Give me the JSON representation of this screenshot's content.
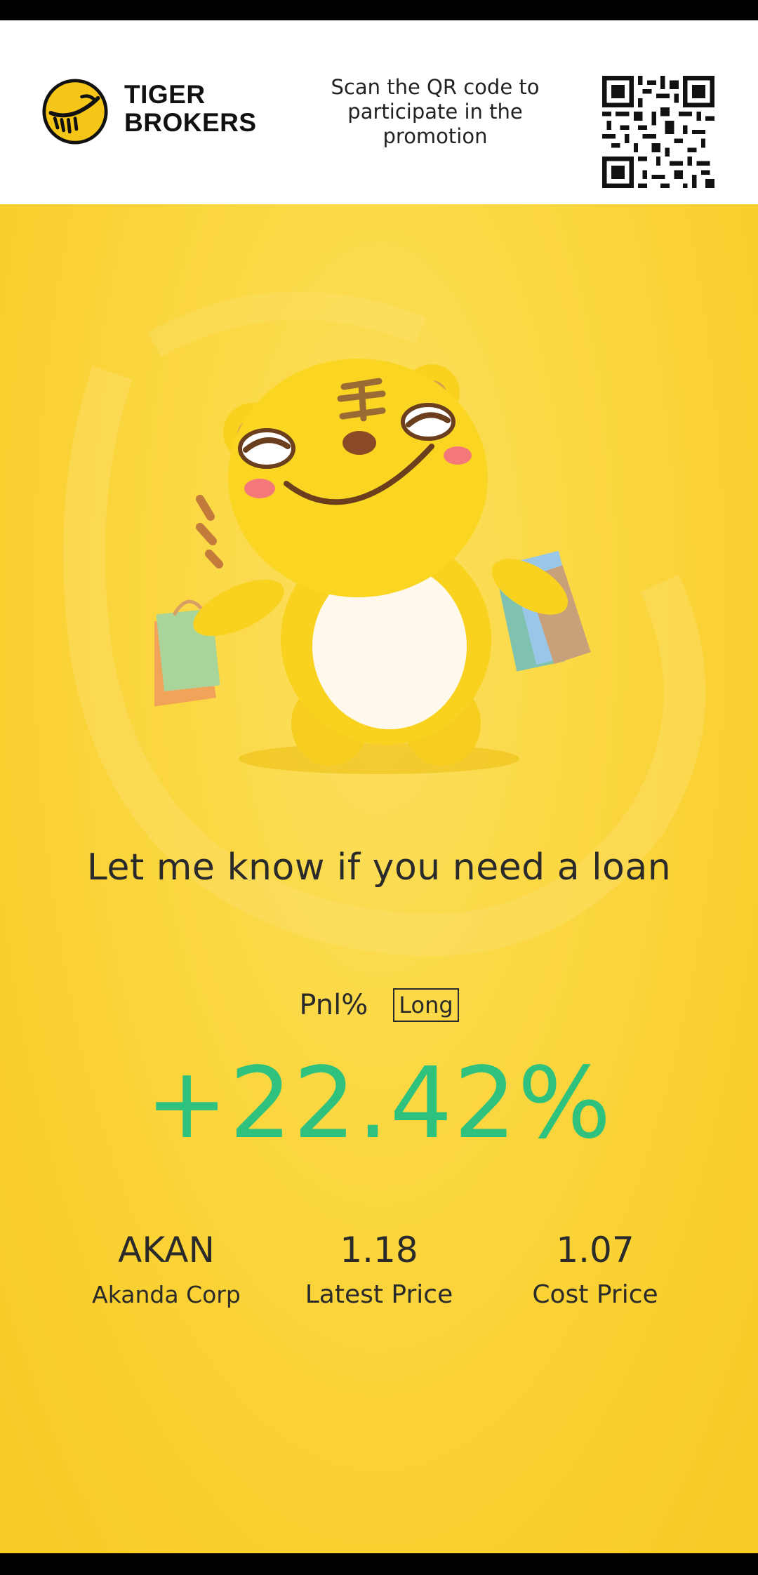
{
  "header": {
    "brand_line1": "TIGER",
    "brand_line2": "BROKERS",
    "qr_note": "Scan the QR code to participate in the promotion"
  },
  "promo": {
    "mascot": "tiger-mascot-with-shopping-bags",
    "tagline": "Let me know if you need a loan"
  },
  "position": {
    "pnl_label": "Pnl%",
    "side": "Long",
    "pnl_value": "+22.42%",
    "ticker": "AKAN",
    "company": "Akanda Corp",
    "latest_price": "1.18",
    "latest_price_label": "Latest Price",
    "cost_price": "1.07",
    "cost_price_label": "Cost Price"
  },
  "colors": {
    "accent_yellow": "#f9cf2e",
    "gain_green": "#2ec27e",
    "text_dark": "#2a2a2a"
  }
}
